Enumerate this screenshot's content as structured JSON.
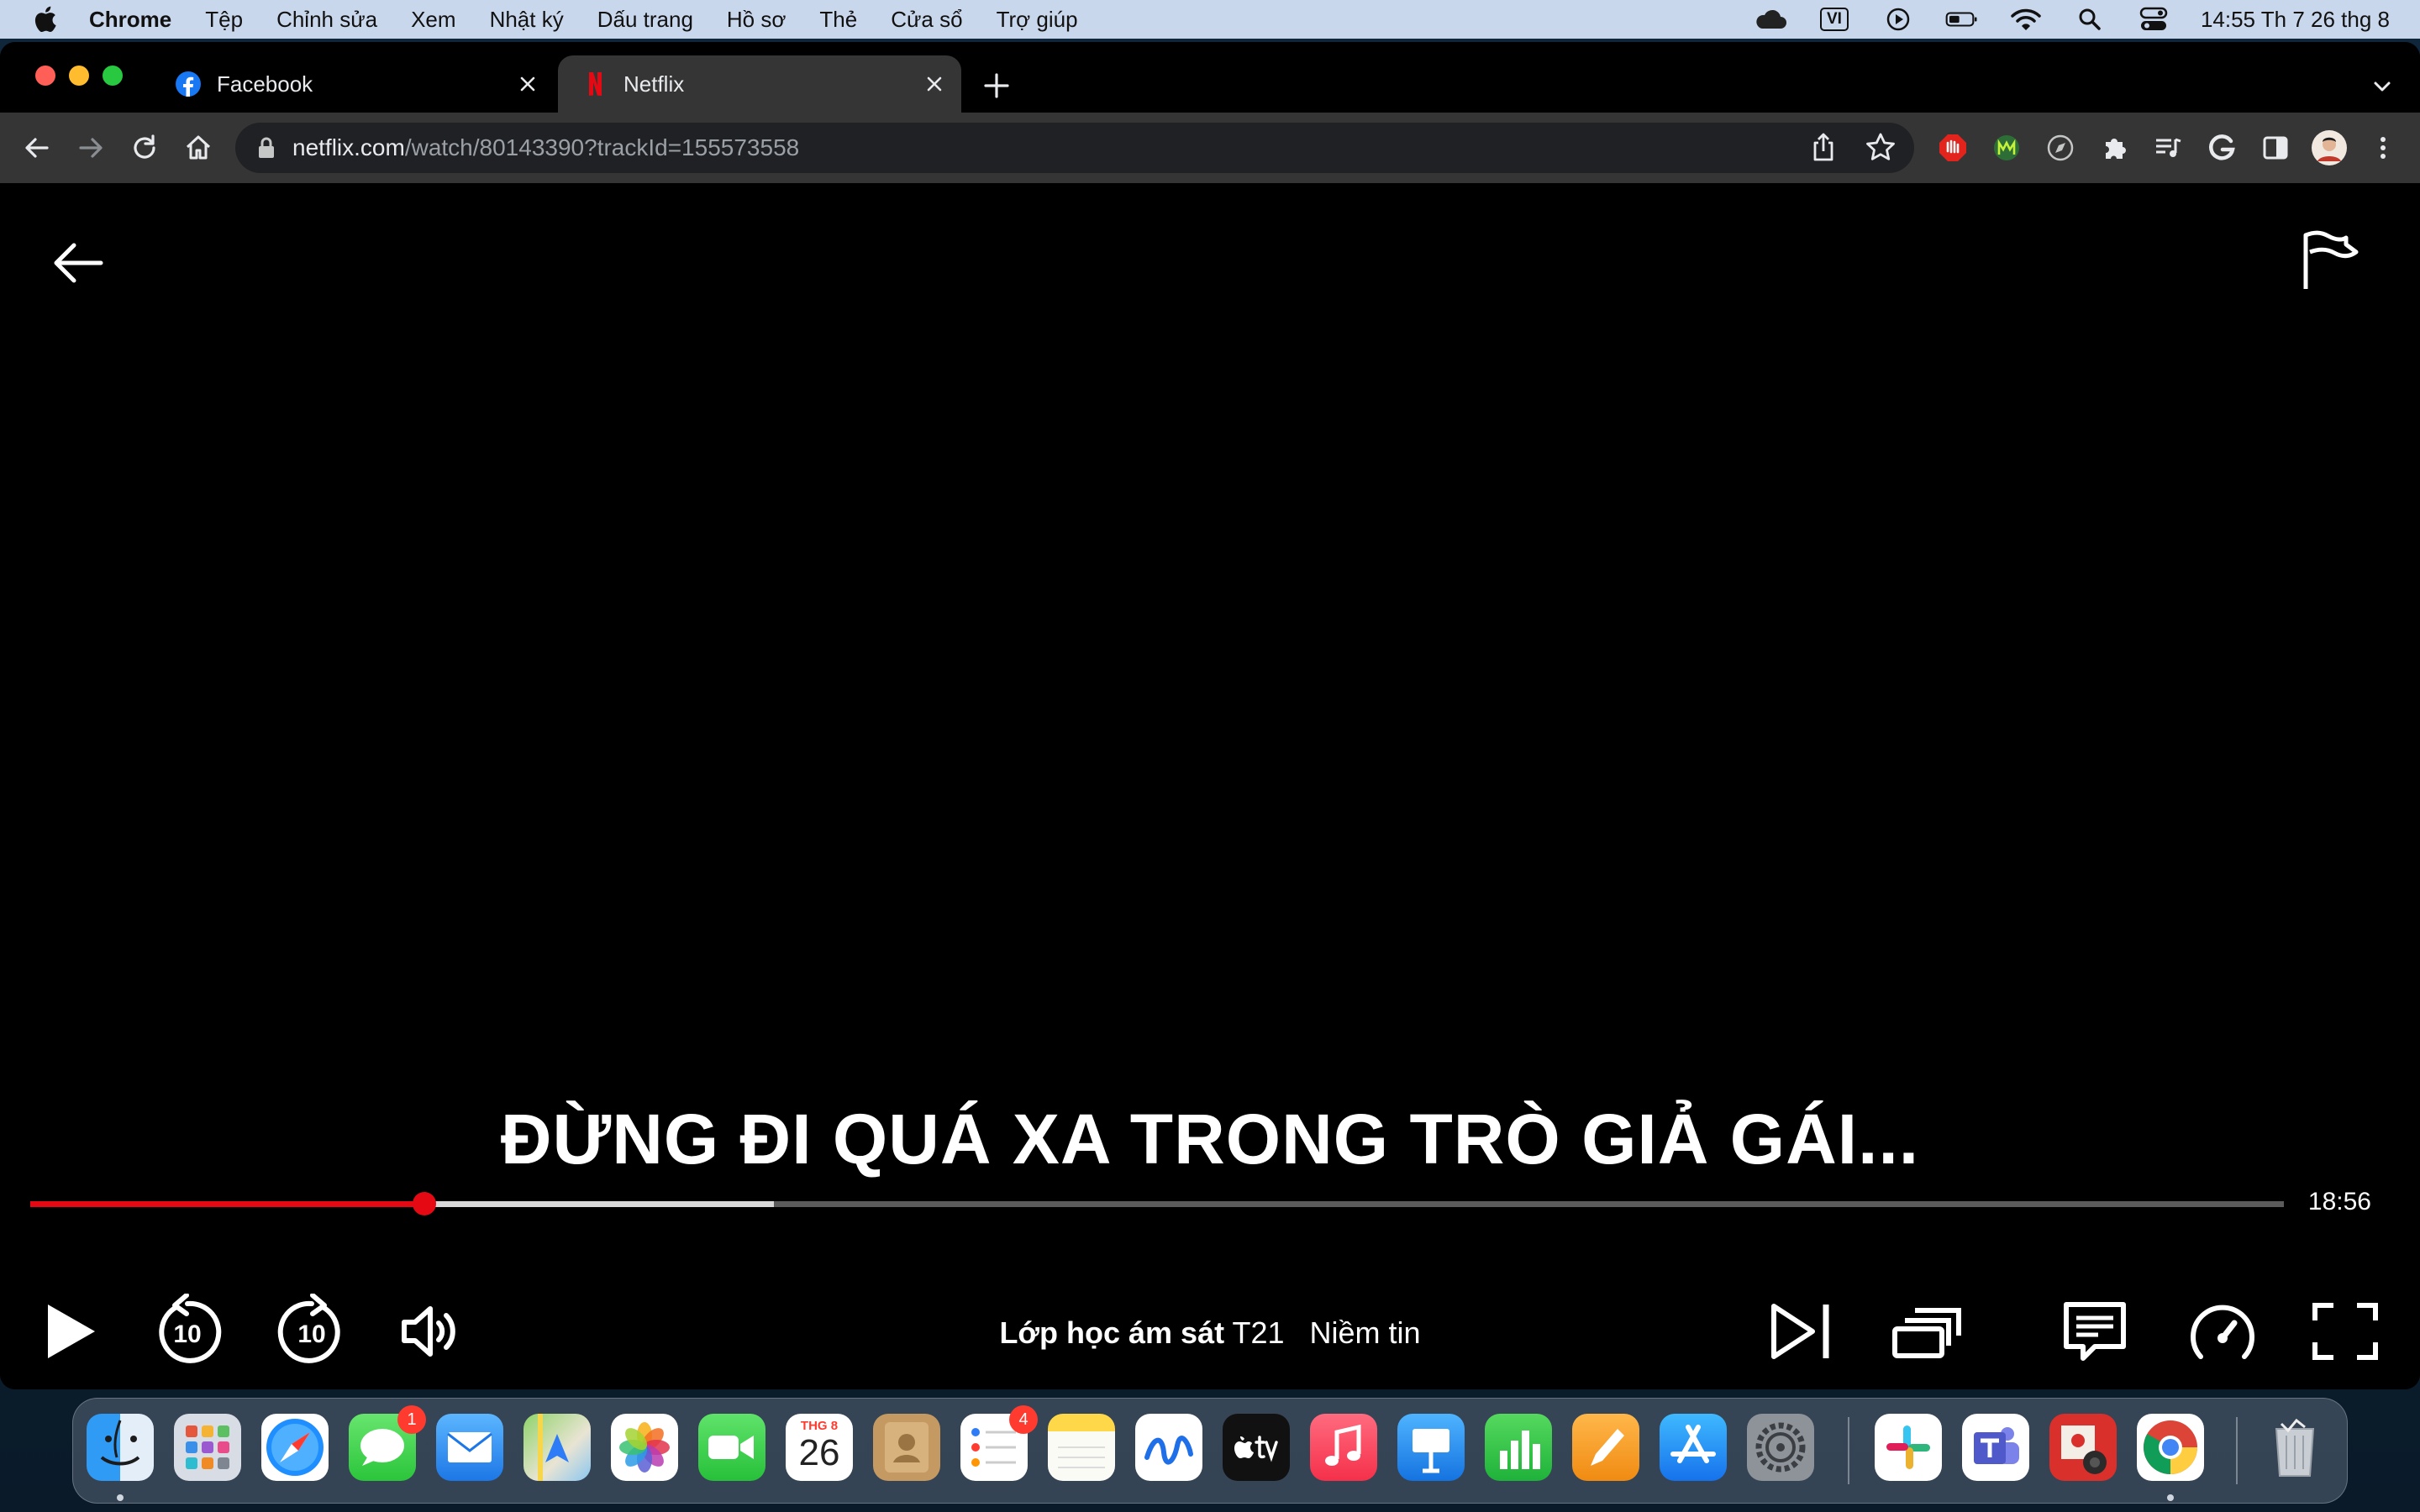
{
  "menubar": {
    "app_name": "Chrome",
    "items": [
      "Tệp",
      "Chỉnh sửa",
      "Xem",
      "Nhật ký",
      "Dấu trang",
      "Hồ sơ",
      "Thẻ",
      "Cửa sổ",
      "Trợ giúp"
    ],
    "input_source": "VI",
    "clock": "14:55 Th 7 26 thg 8"
  },
  "browser": {
    "tabs": [
      {
        "title": "Facebook",
        "active": false
      },
      {
        "title": "Netflix",
        "active": true
      }
    ],
    "url_host": "netflix.com",
    "url_path": "/watch/80143390?trackId=155573558"
  },
  "player": {
    "headline": "ĐỪNG ĐI QUÁ XA TRONG TRÒ GIẢ GÁI...",
    "time_remaining": "18:56",
    "progress_played": 0.175,
    "progress_buffered": 0.33,
    "skip_back_seconds": "10",
    "skip_forward_seconds": "10",
    "show_title": "Lớp học ám sát",
    "episode_code": "T21",
    "episode_title": "Niềm tin",
    "accent_color": "#e50914"
  },
  "dock": {
    "calendar_month": "THG 8",
    "calendar_day": "26",
    "messages_badge": "1",
    "reminders_badge": "4",
    "apps": [
      "finder-icon",
      "launchpad-icon",
      "safari-icon",
      "messages-icon",
      "mail-icon",
      "maps-icon",
      "photos-icon",
      "facetime-icon",
      "calendar-icon",
      "contacts-icon",
      "reminders-icon",
      "notes-icon",
      "freeform-icon",
      "apple-tv-icon",
      "music-icon",
      "keynote-icon",
      "numbers-icon",
      "pages-icon",
      "app-store-icon",
      "system-settings-icon",
      "slack-icon",
      "teams-icon",
      "photo-booth-icon",
      "chrome-icon",
      "trash-icon"
    ]
  }
}
